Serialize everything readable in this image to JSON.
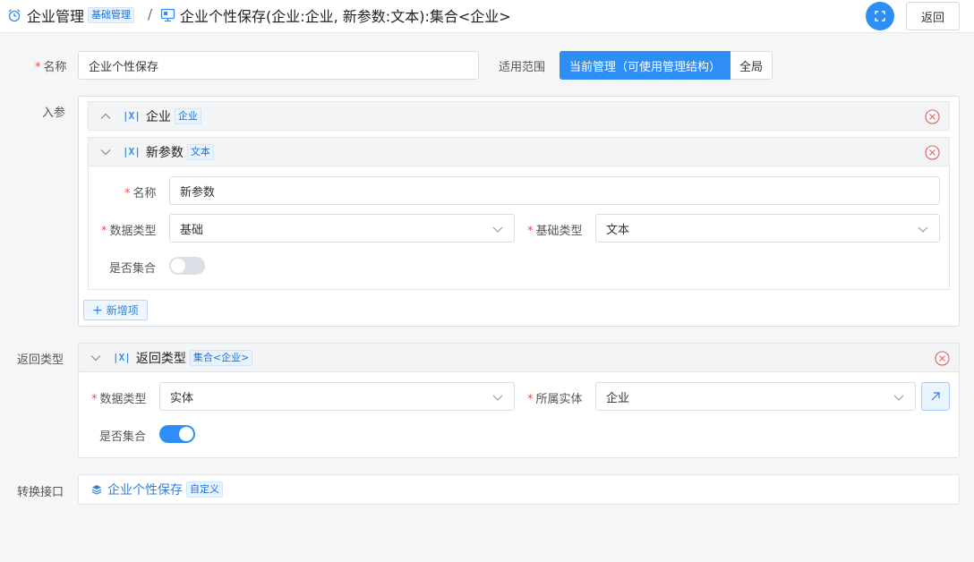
{
  "header": {
    "crumb1": {
      "title": "企业管理",
      "tag": "基础管理"
    },
    "separator": "/",
    "crumb2": {
      "title": "企业个性保存(企业:企业, 新参数:文本):集合<企业>"
    },
    "back_label": "返回"
  },
  "form": {
    "name_label": "名称",
    "name_value": "企业个性保存",
    "scope_label": "适用范围",
    "scope_options": [
      "当前管理（可使用管理结构）",
      "全局"
    ],
    "params_label": "入参",
    "params": [
      {
        "name": "企业",
        "type_tag": "企业",
        "expanded": false
      },
      {
        "name": "新参数",
        "type_tag": "文本",
        "expanded": true,
        "fields": {
          "name_label": "名称",
          "name_value": "新参数",
          "datatype_label": "数据类型",
          "datatype_value": "基础",
          "basetype_label": "基础类型",
          "basetype_value": "文本",
          "collection_label": "是否集合",
          "collection": false
        }
      }
    ],
    "add_item_label": "新增项",
    "return_label": "返回类型",
    "return_type": {
      "name": "返回类型",
      "type_tag": "集合<企业>",
      "datatype_label": "数据类型",
      "datatype_value": "实体",
      "entity_label": "所属实体",
      "entity_value": "企业",
      "collection_label": "是否集合",
      "collection": true
    },
    "convert_label": "转换接口",
    "convert": {
      "name": "企业个性保存",
      "tag": "自定义"
    }
  },
  "colors": {
    "accent": "#2f8ef5",
    "required": "#f04a4a",
    "danger": "#e25c5c"
  }
}
